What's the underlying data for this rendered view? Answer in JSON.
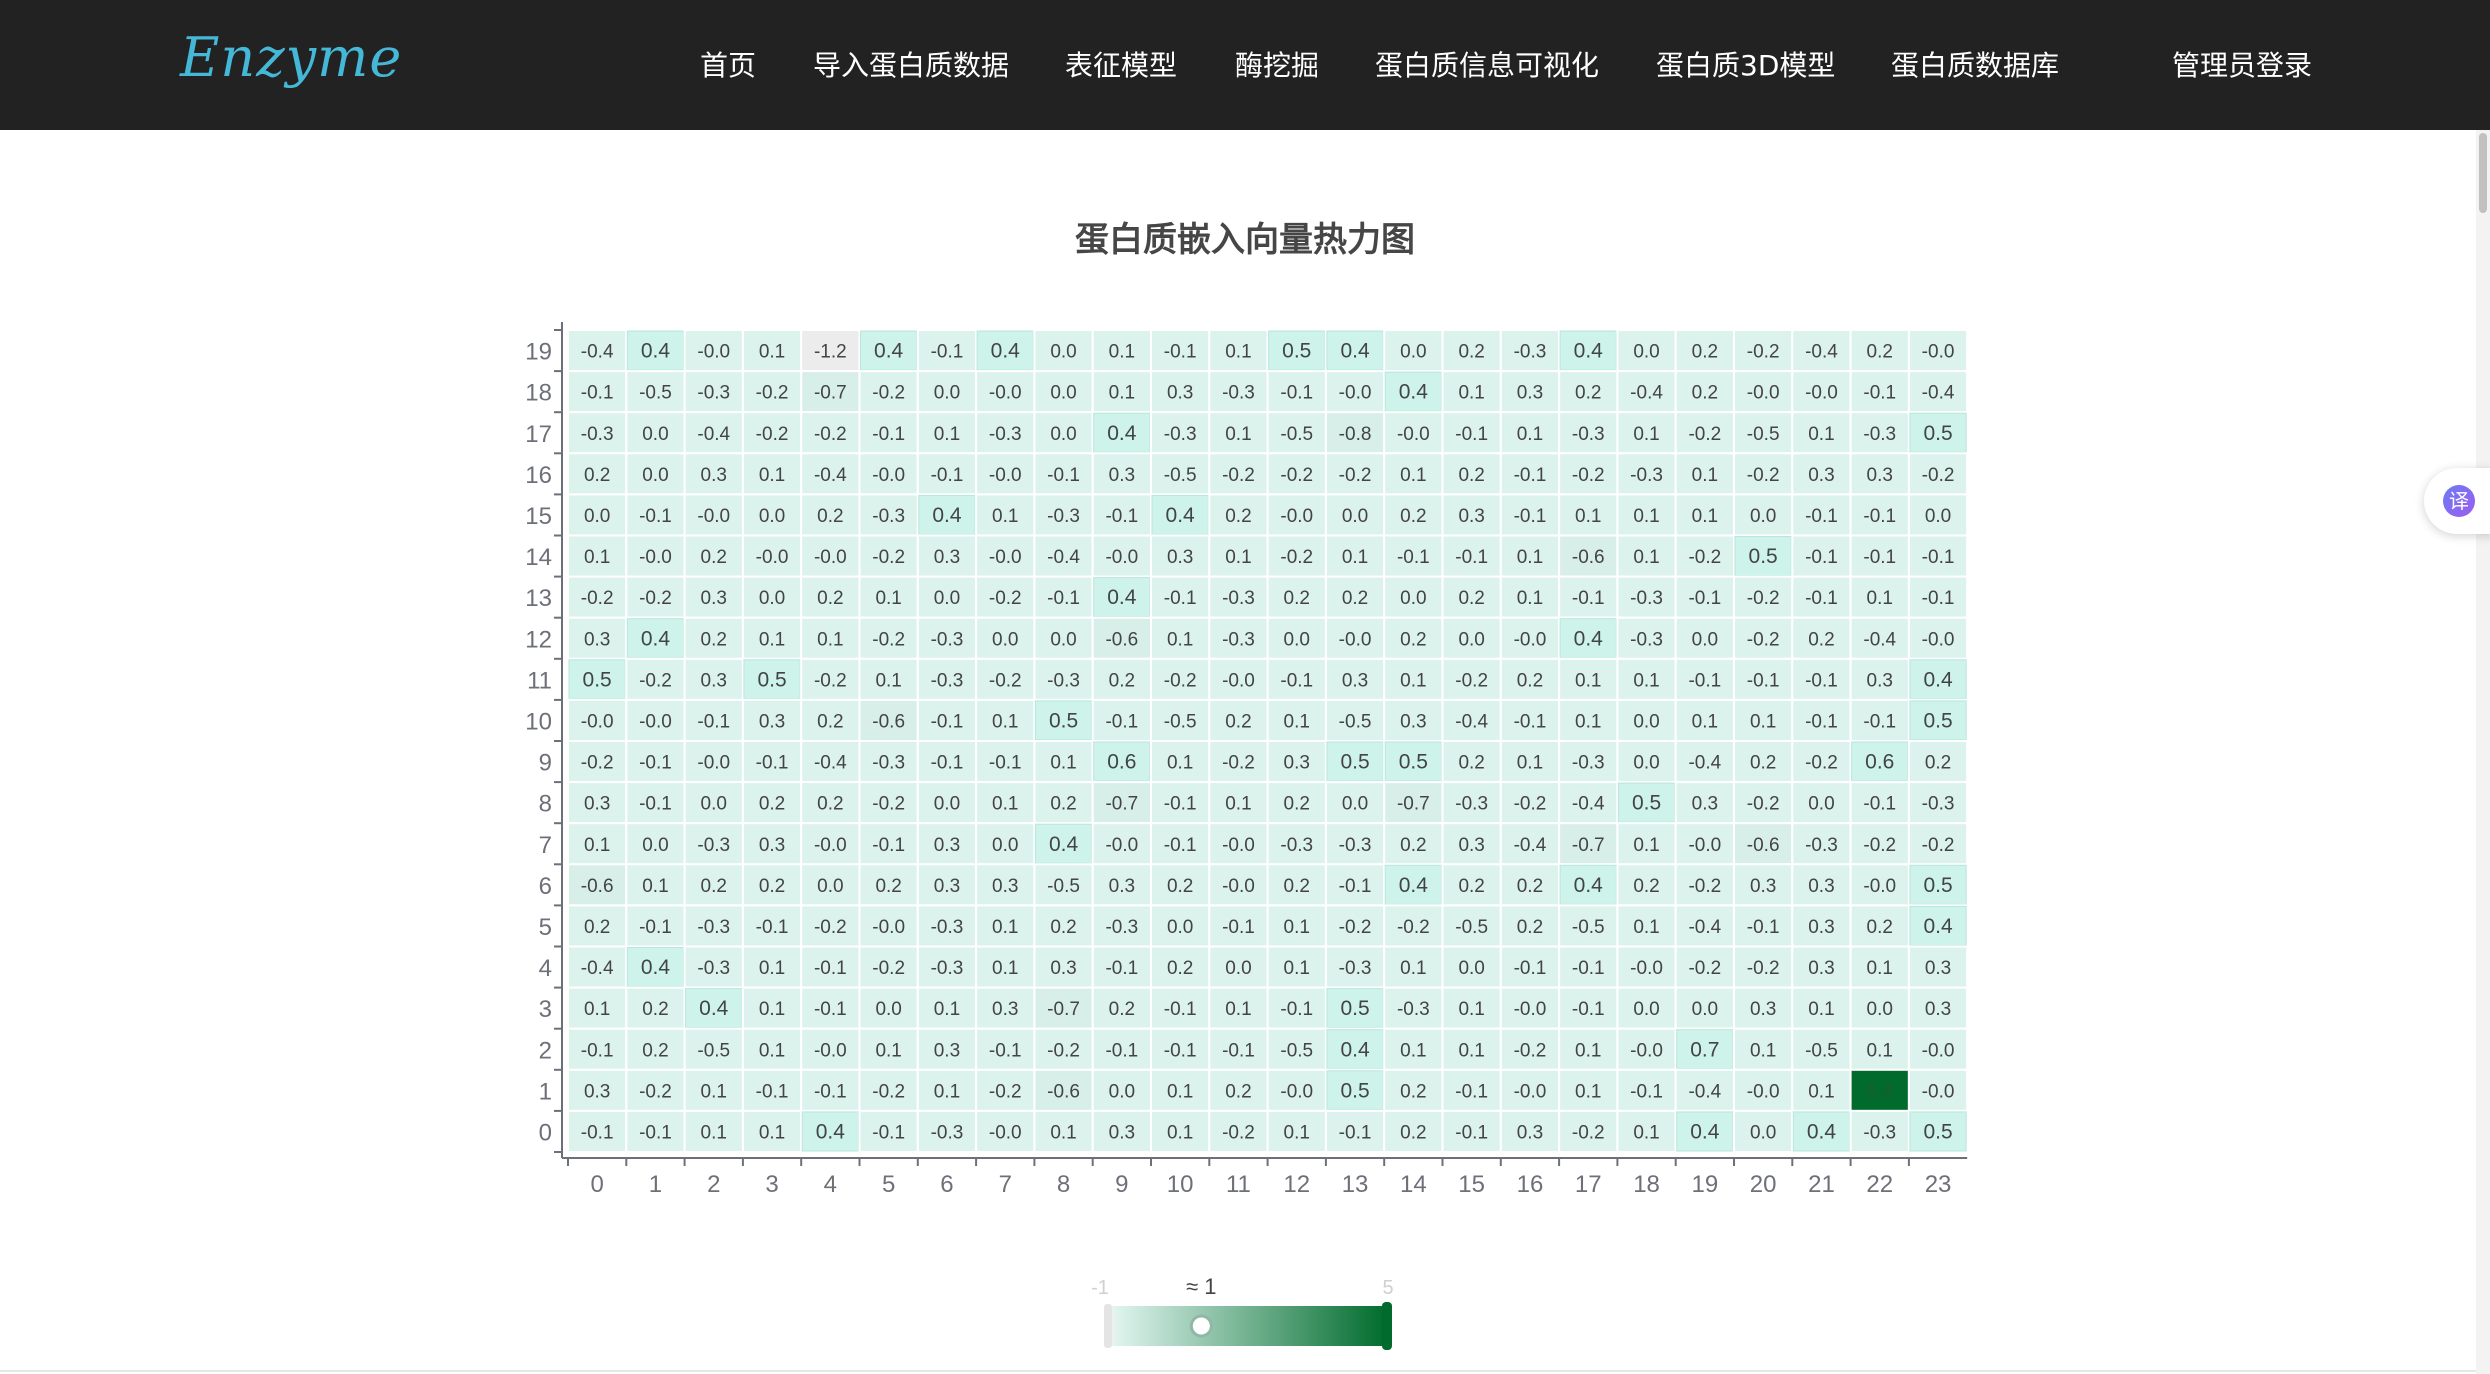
{
  "navbar": {
    "logo": "Enzyme",
    "items": [
      "首页",
      "导入蛋白质数据",
      "表征模型",
      "酶挖掘",
      "蛋白质信息可视化",
      "蛋白质3D模型",
      "蛋白质数据库"
    ],
    "admin_login": "管理员登录"
  },
  "translate_button": {
    "icon": "translate-icon",
    "label": "译"
  },
  "chart_data": {
    "type": "heatmap",
    "title": "蛋白质嵌入向量热力图",
    "x_categories": [
      "0",
      "1",
      "2",
      "3",
      "4",
      "5",
      "6",
      "7",
      "8",
      "9",
      "10",
      "11",
      "12",
      "13",
      "14",
      "15",
      "16",
      "17",
      "18",
      "19",
      "20",
      "21",
      "22",
      "23"
    ],
    "y_categories": [
      "0",
      "1",
      "2",
      "3",
      "4",
      "5",
      "6",
      "7",
      "8",
      "9",
      "10",
      "11",
      "12",
      "13",
      "14",
      "15",
      "16",
      "17",
      "18",
      "19"
    ],
    "values_by_row_from_top": [
      {
        "y": "19",
        "values": [
          -0.4,
          0.4,
          -0.0,
          0.1,
          -1.2,
          0.4,
          -0.1,
          0.4,
          0.0,
          0.1,
          -0.1,
          0.1,
          0.5,
          0.4,
          0.0,
          0.2,
          -0.3,
          0.4,
          0.0,
          0.2,
          -0.2,
          -0.4,
          0.2,
          -0.0
        ]
      },
      {
        "y": "18",
        "values": [
          -0.1,
          -0.5,
          -0.3,
          -0.2,
          -0.7,
          -0.2,
          0.0,
          -0.0,
          0.0,
          0.1,
          0.3,
          -0.3,
          -0.1,
          -0.0,
          0.4,
          0.1,
          0.3,
          0.2,
          -0.4,
          0.2,
          -0.0,
          -0.0,
          -0.1,
          -0.4
        ]
      },
      {
        "y": "17",
        "values": [
          -0.3,
          0.0,
          -0.4,
          -0.2,
          -0.2,
          -0.1,
          0.1,
          -0.3,
          0.0,
          0.4,
          -0.3,
          0.1,
          -0.5,
          -0.8,
          -0.0,
          -0.1,
          0.1,
          -0.3,
          0.1,
          -0.2,
          -0.5,
          0.1,
          -0.3,
          0.5
        ]
      },
      {
        "y": "16",
        "values": [
          0.2,
          0.0,
          0.3,
          0.1,
          -0.4,
          -0.0,
          -0.1,
          -0.0,
          -0.1,
          0.3,
          -0.5,
          -0.2,
          -0.2,
          -0.2,
          0.1,
          0.2,
          -0.1,
          -0.2,
          -0.3,
          0.1,
          -0.2,
          0.3,
          0.3,
          -0.2
        ]
      },
      {
        "y": "15",
        "values": [
          0.0,
          -0.1,
          -0.0,
          0.0,
          0.2,
          -0.3,
          0.4,
          0.1,
          -0.3,
          -0.1,
          0.4,
          0.2,
          -0.0,
          0.0,
          0.2,
          0.3,
          -0.1,
          0.1,
          0.1,
          0.1,
          0.0,
          -0.1,
          -0.1,
          0.0
        ]
      },
      {
        "y": "14",
        "values": [
          0.1,
          -0.0,
          0.2,
          -0.0,
          -0.0,
          -0.2,
          0.3,
          -0.0,
          -0.4,
          -0.0,
          0.3,
          0.1,
          -0.2,
          0.1,
          -0.1,
          -0.1,
          0.1,
          -0.6,
          0.1,
          -0.2,
          0.5,
          -0.1,
          -0.1,
          -0.1
        ]
      },
      {
        "y": "13",
        "values": [
          -0.2,
          -0.2,
          0.3,
          0.0,
          0.2,
          0.1,
          0.0,
          -0.2,
          -0.1,
          0.4,
          -0.1,
          -0.3,
          0.2,
          0.2,
          0.0,
          0.2,
          0.1,
          -0.1,
          -0.3,
          -0.1,
          -0.2,
          -0.1,
          0.1,
          -0.1
        ]
      },
      {
        "y": "12",
        "values": [
          0.3,
          0.4,
          0.2,
          0.1,
          0.1,
          -0.2,
          -0.3,
          0.0,
          0.0,
          -0.6,
          0.1,
          -0.3,
          0.0,
          -0.0,
          0.2,
          0.0,
          -0.0,
          0.4,
          -0.3,
          0.0,
          -0.2,
          0.2,
          -0.4,
          -0.0
        ]
      },
      {
        "y": "11",
        "values": [
          0.5,
          -0.2,
          0.3,
          0.5,
          -0.2,
          0.1,
          -0.3,
          -0.2,
          -0.3,
          0.2,
          -0.2,
          -0.0,
          -0.1,
          0.3,
          0.1,
          -0.2,
          0.2,
          0.1,
          0.1,
          -0.1,
          -0.1,
          -0.1,
          0.3,
          0.4
        ]
      },
      {
        "y": "10",
        "values": [
          -0.0,
          -0.0,
          -0.1,
          0.3,
          0.2,
          -0.6,
          -0.1,
          0.1,
          0.5,
          -0.1,
          -0.5,
          0.2,
          0.1,
          -0.5,
          0.3,
          -0.4,
          -0.1,
          0.1,
          0.0,
          0.1,
          0.1,
          -0.1,
          -0.1,
          0.5
        ]
      },
      {
        "y": "9",
        "values": [
          -0.2,
          -0.1,
          -0.0,
          -0.1,
          -0.4,
          -0.3,
          -0.1,
          -0.1,
          0.1,
          0.6,
          0.1,
          -0.2,
          0.3,
          0.5,
          0.5,
          0.2,
          0.1,
          -0.3,
          0.0,
          -0.4,
          0.2,
          -0.2,
          0.6,
          0.2
        ]
      },
      {
        "y": "8",
        "values": [
          0.3,
          -0.1,
          0.0,
          0.2,
          0.2,
          -0.2,
          0.0,
          0.1,
          0.2,
          -0.7,
          -0.1,
          0.1,
          0.2,
          0.0,
          -0.7,
          -0.3,
          -0.2,
          -0.4,
          0.5,
          0.3,
          -0.2,
          0.0,
          -0.1,
          -0.3
        ]
      },
      {
        "y": "7",
        "values": [
          0.1,
          0.0,
          -0.3,
          0.3,
          -0.0,
          -0.1,
          0.3,
          0.0,
          0.4,
          -0.0,
          -0.1,
          -0.0,
          -0.3,
          -0.3,
          0.2,
          0.3,
          -0.4,
          -0.7,
          0.1,
          -0.0,
          -0.6,
          -0.3,
          -0.2,
          -0.2
        ]
      },
      {
        "y": "6",
        "values": [
          -0.6,
          0.1,
          0.2,
          0.2,
          0.0,
          0.2,
          0.3,
          0.3,
          -0.5,
          0.3,
          0.2,
          -0.0,
          0.2,
          -0.1,
          0.4,
          0.2,
          0.2,
          0.4,
          0.2,
          -0.2,
          0.3,
          0.3,
          -0.0,
          0.5
        ]
      },
      {
        "y": "5",
        "values": [
          0.2,
          -0.1,
          -0.3,
          -0.1,
          -0.2,
          -0.0,
          -0.3,
          0.1,
          0.2,
          -0.3,
          0.0,
          -0.1,
          0.1,
          -0.2,
          -0.2,
          -0.5,
          0.2,
          -0.5,
          0.1,
          -0.4,
          -0.1,
          0.3,
          0.2,
          0.4
        ]
      },
      {
        "y": "4",
        "values": [
          -0.4,
          0.4,
          -0.3,
          0.1,
          -0.1,
          -0.2,
          -0.3,
          0.1,
          0.3,
          -0.1,
          0.2,
          0.0,
          0.1,
          -0.3,
          0.1,
          0.0,
          -0.1,
          -0.1,
          -0.0,
          -0.2,
          -0.2,
          0.3,
          0.1,
          0.3
        ]
      },
      {
        "y": "3",
        "values": [
          0.1,
          0.2,
          0.4,
          0.1,
          -0.1,
          0.0,
          0.1,
          0.3,
          -0.7,
          0.2,
          -0.1,
          0.1,
          -0.1,
          0.5,
          -0.3,
          0.1,
          -0.0,
          -0.1,
          0.0,
          0.0,
          0.3,
          0.1,
          0.0,
          0.3
        ]
      },
      {
        "y": "2",
        "values": [
          -0.1,
          0.2,
          -0.5,
          0.1,
          -0.0,
          0.1,
          0.3,
          -0.1,
          -0.2,
          -0.1,
          -0.1,
          -0.1,
          -0.5,
          0.4,
          0.1,
          0.1,
          -0.2,
          0.1,
          -0.0,
          0.7,
          0.1,
          -0.5,
          0.1,
          -0.0
        ]
      },
      {
        "y": "1",
        "values": [
          0.3,
          -0.2,
          0.1,
          -0.1,
          -0.1,
          -0.2,
          0.1,
          -0.2,
          -0.6,
          0.0,
          0.1,
          0.2,
          -0.0,
          0.5,
          0.2,
          -0.1,
          -0.0,
          0.1,
          -0.1,
          -0.4,
          -0.0,
          0.1,
          5.4,
          -0.0
        ]
      },
      {
        "y": "0",
        "values": [
          -0.1,
          -0.1,
          0.1,
          0.1,
          0.4,
          -0.1,
          -0.3,
          -0.0,
          0.1,
          0.3,
          0.1,
          -0.2,
          0.1,
          -0.1,
          0.2,
          -0.1,
          0.3,
          -0.2,
          0.1,
          0.4,
          0.0,
          0.4,
          -0.3,
          0.5
        ]
      }
    ],
    "visual_map": {
      "min_label": "-1",
      "max_label": "5",
      "min": -1,
      "max": 5,
      "handle_label": "≈ 1",
      "handle_value": 1,
      "color_low": "#dcf2ec",
      "color_high": "#006b2c",
      "highlight_color": "#cdf3ea"
    },
    "grid": true,
    "data_labels": true
  }
}
